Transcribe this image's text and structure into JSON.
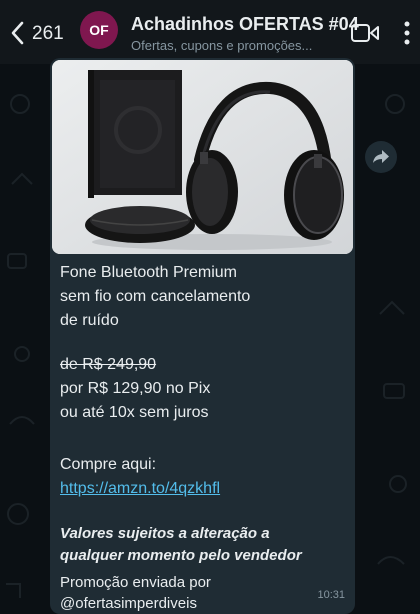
{
  "header": {
    "back_count": "261",
    "avatar_initials": "OF",
    "title": "Achadinhos OFERTAS #04",
    "subtitle": "Ofertas, cupons e promoções..."
  },
  "message": {
    "product_lines": [
      "Fone Bluetooth Premium",
      "sem fio com cancelamento",
      "de ruído"
    ],
    "old_price": "de R$ 249,90",
    "new_price": "por R$ 129,90 no Pix",
    "installments": "ou até 10x sem juros",
    "buy_label": "Compre aqui:",
    "link": "https://amzn.to/4qzkhfl",
    "disclaimer_lines": [
      "Valores sujeitos a alteração a",
      "qualquer momento pelo vendedor"
    ],
    "footer_lines": [
      "Promoção enviada por",
      "@ofertasimperdiveis"
    ],
    "time": "10:31"
  },
  "colors": {
    "bg": "#0b1014",
    "header": "#12171b",
    "bubble": "#1f2c34",
    "avatar": "#7f174f",
    "link": "#53bdeb"
  },
  "icons": [
    "chevron-left-icon",
    "video-call-icon",
    "more-vertical-icon",
    "forward-icon"
  ]
}
